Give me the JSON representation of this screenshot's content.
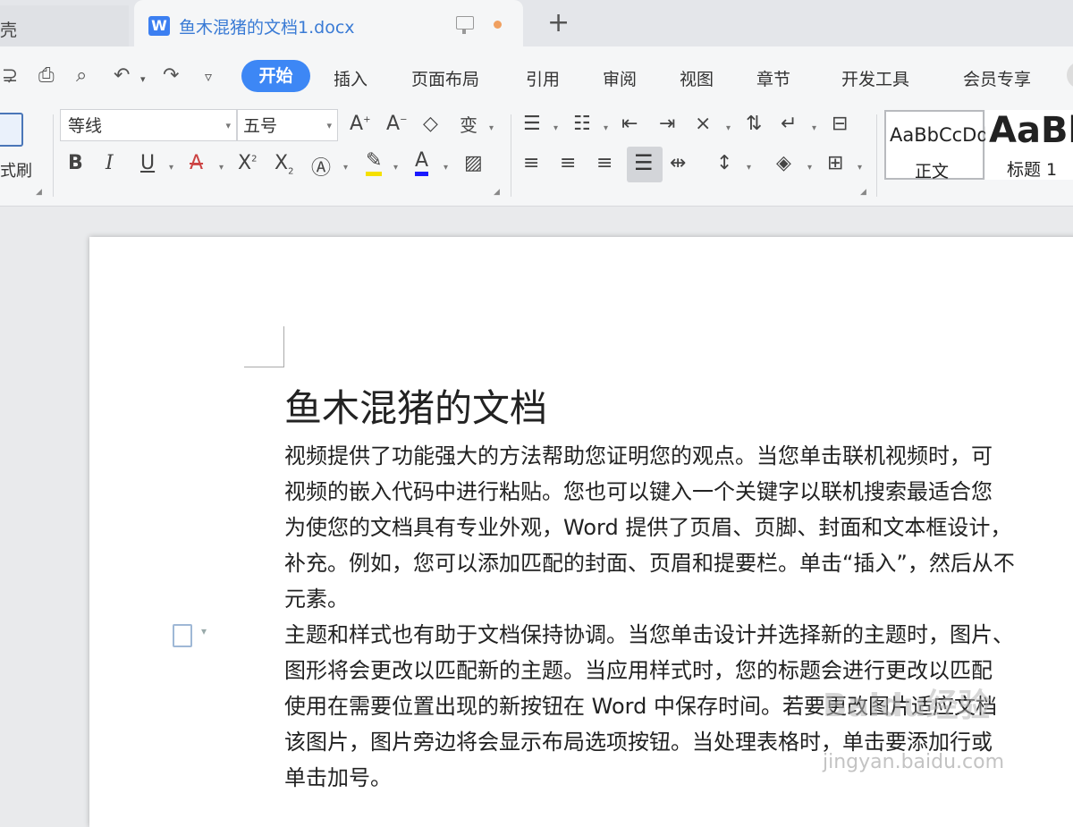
{
  "titlebar": {
    "prev_tab_label": "壳",
    "doc_icon_letter": "W",
    "active_tab_title": "鱼木混猪的文档1.docx",
    "new_tab_symbol": "+"
  },
  "menubar": {
    "format_painter_label": "式刷",
    "items": [
      "开始",
      "插入",
      "页面布局",
      "引用",
      "审阅",
      "视图",
      "章节",
      "开发工具",
      "会员专享"
    ]
  },
  "ribbon": {
    "font_name": "等线",
    "font_size": "五号",
    "styles": [
      {
        "sample": "AaBbCcDd",
        "name": "正文"
      },
      {
        "sample": "AaBb",
        "name": "标题 1"
      }
    ],
    "accent_color": "#3d87f5",
    "highlight_color": "#f5e000",
    "font_color": "#1a1aff"
  },
  "document": {
    "title": "鱼木混猪的文档",
    "paragraph1": [
      "视频提供了功能强大的方法帮助您证明您的观点。当您单击联机视频时，可",
      "视频的嵌入代码中进行粘贴。您也可以键入一个关键字以联机搜索最适合您",
      "为使您的文档具有专业外观，Word 提供了页眉、页脚、封面和文本框设计，",
      "补充。例如，您可以添加匹配的封面、页眉和提要栏。单击“插入”，然后从不",
      "元素。"
    ],
    "paragraph2": [
      "主题和样式也有助于文档保持协调。当您单击设计并选择新的主题时，图片、",
      "图形将会更改以匹配新的主题。当应用样式时，您的标题会进行更改以匹配",
      "使用在需要位置出现的新按钮在 Word 中保存时间。若要更改图片适应文档",
      "该图片，图片旁边将会显示布局选项按钮。当处理表格时，单击要添加行或",
      "单击加号。"
    ]
  },
  "watermark": {
    "text": "Baidu经验",
    "url": "jingyan.baidu.com"
  }
}
